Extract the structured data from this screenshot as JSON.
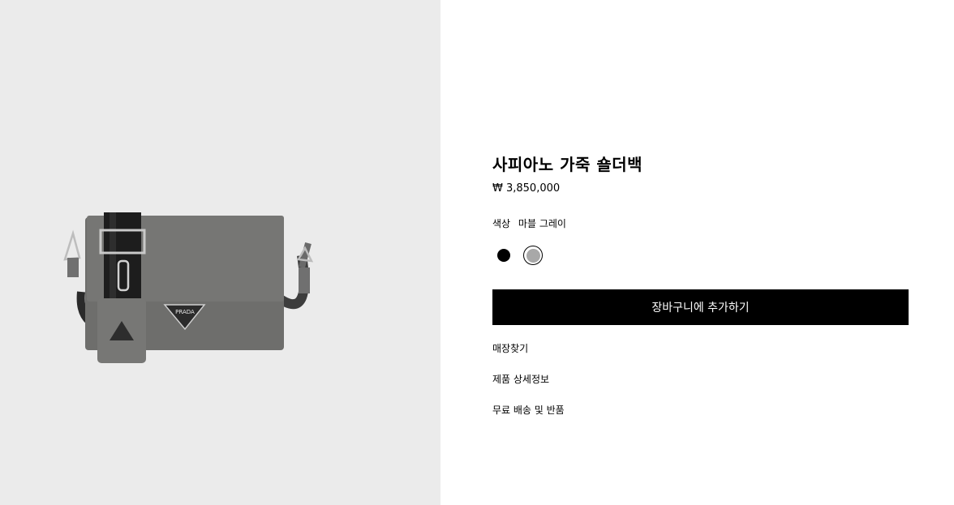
{
  "product": {
    "title": "사피아노 가죽 숄더백",
    "price": "₩ 3,850,000",
    "color_label": "색상",
    "color_value": "마블 그레이",
    "image_alt": "product-photo-grey-shoulder-bag",
    "logo_text": "PRADA"
  },
  "swatches": [
    {
      "name": "black",
      "color": "#000000",
      "selected": false
    },
    {
      "name": "marble-grey",
      "color": "#a8a8a8",
      "selected": true
    }
  ],
  "actions": {
    "add_to_cart_label": "장바구니에 추가하기"
  },
  "links": {
    "store_locator": "매장찾기",
    "product_details": "제품 상세정보",
    "shipping_returns": "무료 배송 및 반품"
  },
  "colors": {
    "image_background": "#ebebeb",
    "bag_body": "#6e6e6c",
    "button_bg": "#000000",
    "button_text": "#ffffff"
  }
}
